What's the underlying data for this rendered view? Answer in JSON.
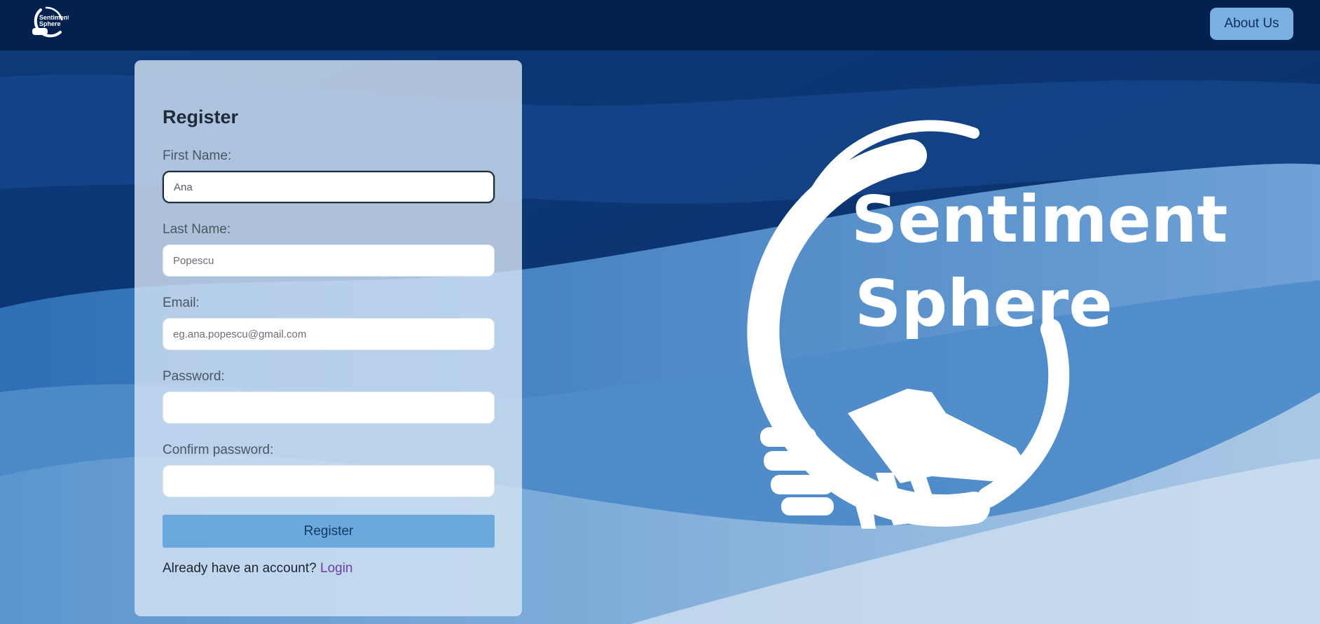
{
  "navbar": {
    "logo_text_top": "Sentiment",
    "logo_text_bottom": "Sphere",
    "about_label": "About Us"
  },
  "form": {
    "title": "Register",
    "first_name": {
      "label": "First Name:",
      "value": "Ana",
      "placeholder": ""
    },
    "last_name": {
      "label": "Last Name:",
      "value": "",
      "placeholder": "Popescu"
    },
    "email": {
      "label": "Email:",
      "value": "",
      "placeholder": "eg.ana.popescu@gmail.com"
    },
    "password": {
      "label": "Password:",
      "value": "",
      "placeholder": ""
    },
    "confirm_password": {
      "label": "Confirm password:",
      "value": "",
      "placeholder": ""
    },
    "submit_label": "Register",
    "login_prompt": "Already have an account?",
    "login_link": "Login"
  },
  "hero": {
    "logo_line1": "Sentiment",
    "logo_line2": "Sphere"
  },
  "colors": {
    "navbar": "#03214f",
    "accent": "#6aa8dd",
    "link": "#6b3fa0"
  }
}
